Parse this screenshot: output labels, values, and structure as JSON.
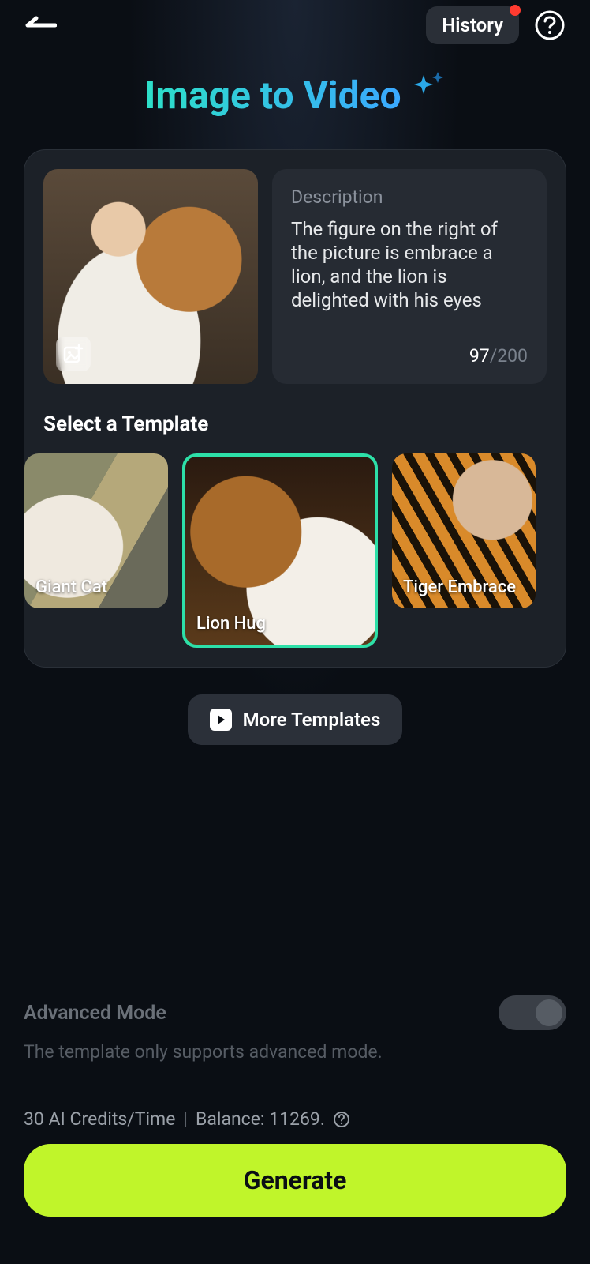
{
  "header": {
    "history_label": "History",
    "has_history_notification": true
  },
  "title": "Image to Video",
  "description": {
    "label": "Description",
    "text": "The figure on the right of the picture is embrace a lion, and the lion is delighted with his eyes",
    "count": "97",
    "max": "/200"
  },
  "templates": {
    "section_title": "Select a Template",
    "items": [
      {
        "label": "Giant Cat",
        "selected": false
      },
      {
        "label": "Lion Hug",
        "selected": true
      },
      {
        "label": "Tiger Embrace",
        "selected": false
      }
    ],
    "more_label": "More Templates"
  },
  "advanced": {
    "label": "Advanced Mode",
    "sub": "The template only supports advanced mode.",
    "enabled": false
  },
  "credits": {
    "cost": "30 AI Credits/Time",
    "balance": "Balance: 11269."
  },
  "generate_label": "Generate"
}
